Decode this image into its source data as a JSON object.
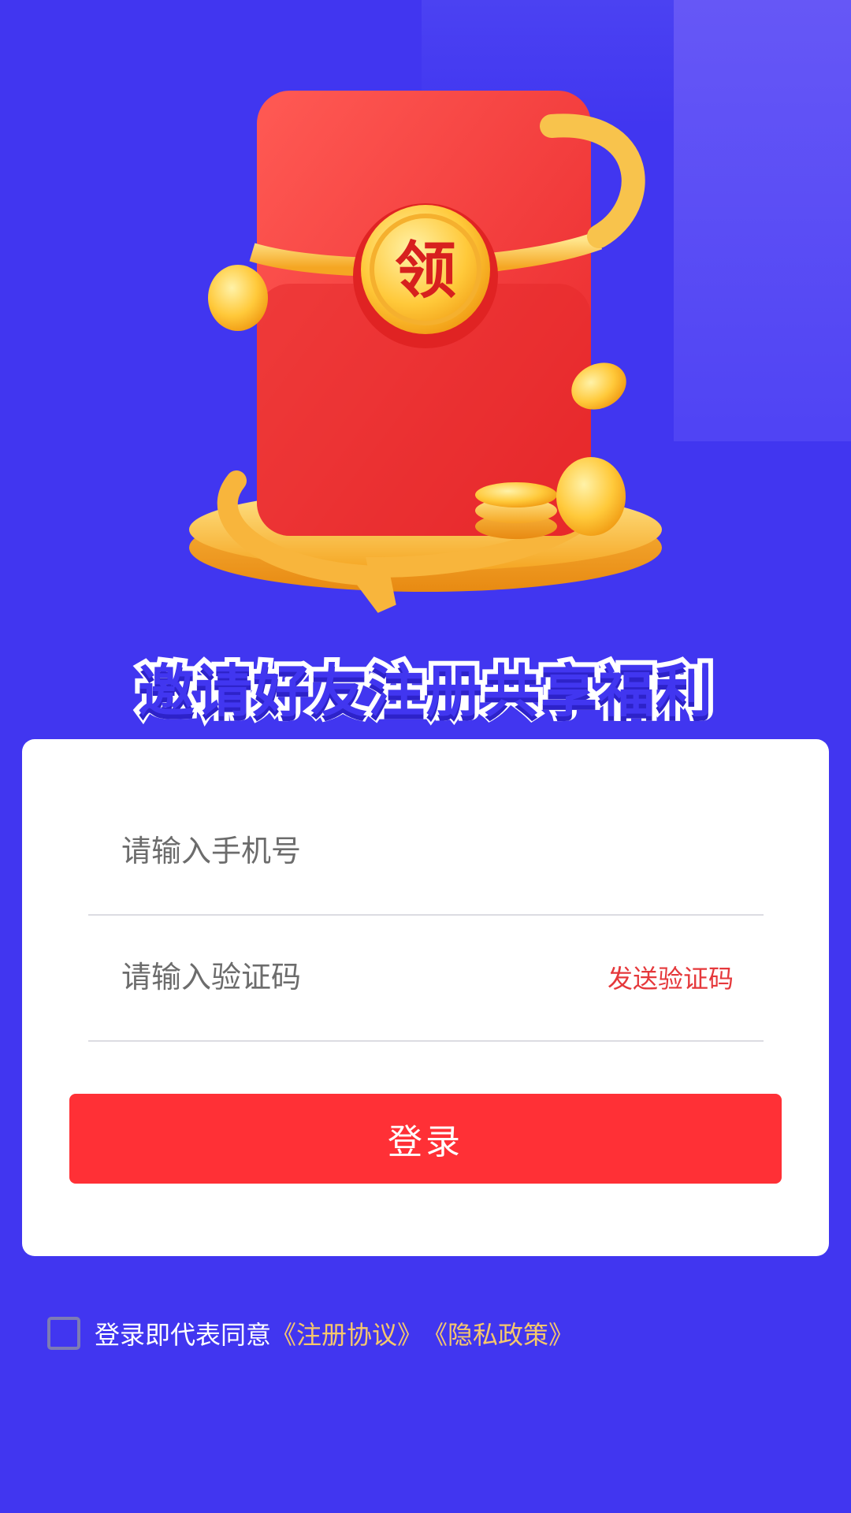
{
  "hero": {
    "badge_char": "领"
  },
  "slogan": "邀请好友注册共享福利",
  "form": {
    "phone_placeholder": "请输入手机号",
    "code_placeholder": "请输入验证码",
    "send_code_label": "发送验证码",
    "login_label": "登录"
  },
  "agreement": {
    "prefix": "登录即代表同意",
    "register_link": "《注册协议》",
    "privacy_link": "《隐私政策》",
    "checked": false
  },
  "colors": {
    "background": "#4136F0",
    "login_button": "#FF3036",
    "send_code": "#E5383B",
    "link": "#F6C76C"
  }
}
